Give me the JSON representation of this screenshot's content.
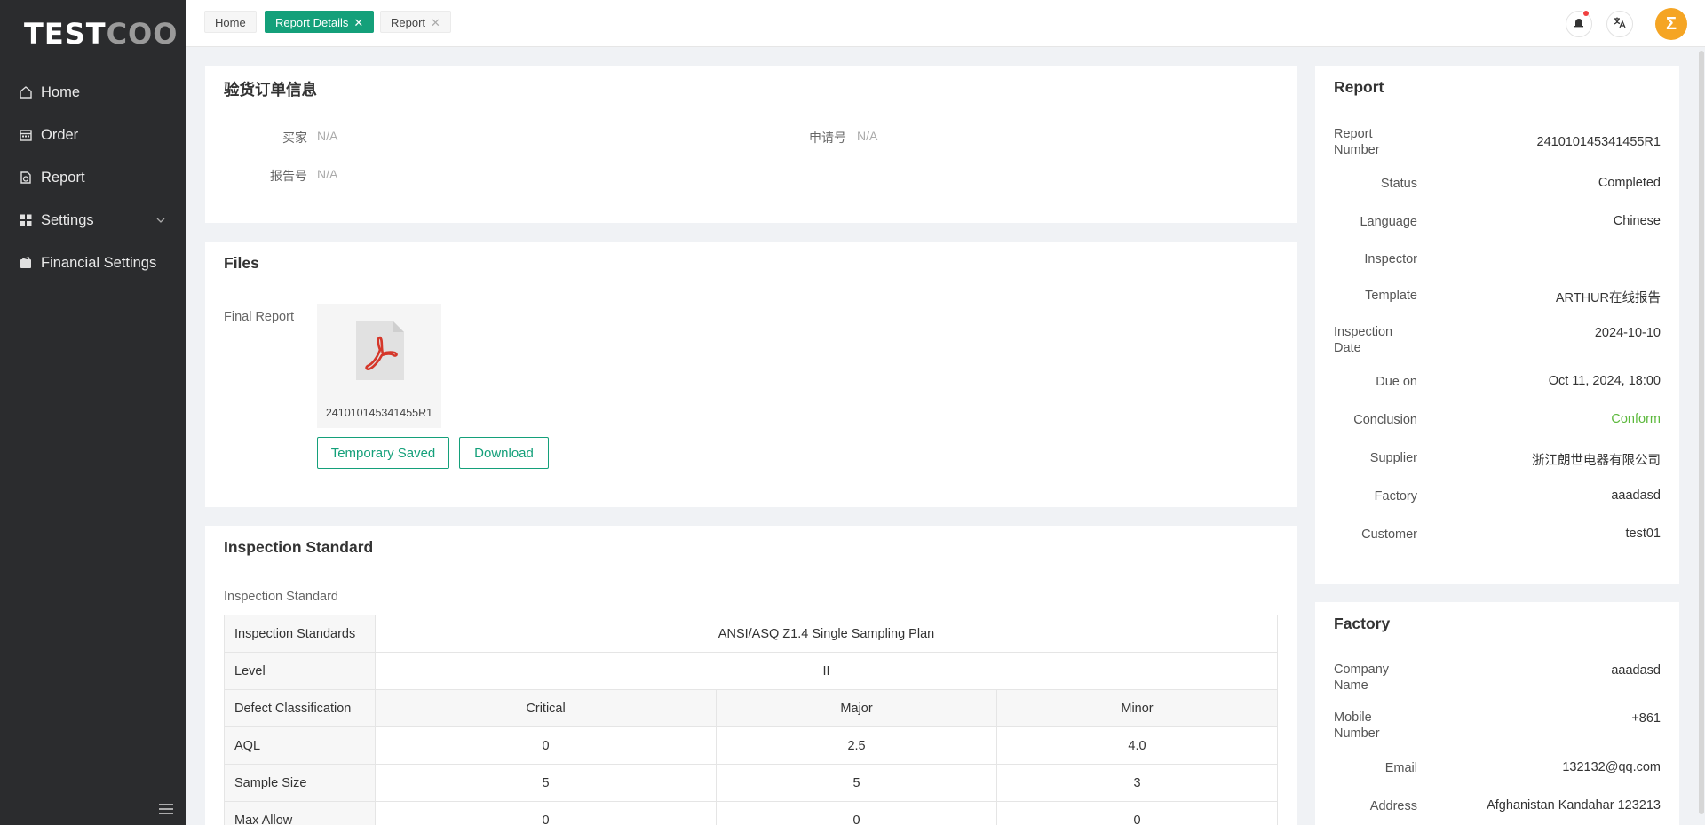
{
  "app": {
    "logo_part1": "TEST",
    "logo_part2": "COO"
  },
  "sidebar": {
    "items": [
      {
        "label": "Home",
        "icon": "home-icon"
      },
      {
        "label": "Order",
        "icon": "calendar-icon"
      },
      {
        "label": "Report",
        "icon": "report-icon"
      },
      {
        "label": "Settings",
        "icon": "grid-icon",
        "has_children": true
      },
      {
        "label": "Financial Settings",
        "icon": "wallet-icon"
      }
    ]
  },
  "tabs": [
    {
      "label": "Home"
    },
    {
      "label": "Report Details",
      "active": true,
      "closable": true
    },
    {
      "label": "Report",
      "closable": true
    }
  ],
  "topbar": {
    "avatar_letter": "Σ",
    "accent_color": "#14a07a"
  },
  "order_info": {
    "title": "验货订单信息",
    "fields": [
      {
        "label": "买家",
        "value": "N/A"
      },
      {
        "label": "申请号",
        "value": "N/A"
      },
      {
        "label": "报告号",
        "value": "N/A"
      }
    ]
  },
  "files": {
    "title": "Files",
    "final_report_label": "Final Report",
    "file_name": "241010145341455R1",
    "temp_saved_label": "Temporary Saved",
    "download_label": "Download"
  },
  "inspection_standard": {
    "title": "Inspection Standard",
    "subtitle": "Inspection Standard",
    "rows": {
      "standards_label": "Inspection Standards",
      "standards_value": "ANSI/ASQ Z1.4 Single Sampling Plan",
      "level_label": "Level",
      "level_value": "II",
      "defect_label": "Defect Classification",
      "headers": [
        "Critical",
        "Major",
        "Minor"
      ],
      "aql_label": "AQL",
      "aql": [
        "0",
        "2.5",
        "4.0"
      ],
      "sample_label": "Sample Size",
      "sample": [
        "5",
        "5",
        "3"
      ],
      "max_label": "Max Allow",
      "max": [
        "0",
        "0",
        "0"
      ]
    }
  },
  "report_panel": {
    "title": "Report",
    "number_label": "Report Number",
    "number": "241010145341455R1",
    "status_label": "Status",
    "status": "Completed",
    "language_label": "Language",
    "language": "Chinese",
    "inspector_label": "Inspector",
    "inspector": "",
    "template_label": "Template",
    "template": "ARTHUR在线报告",
    "inspection_date_label": "Inspection Date",
    "inspection_date": "2024-10-10",
    "due_label": "Due on",
    "due": "Oct 11, 2024, 18:00",
    "conclusion_label": "Conclusion",
    "conclusion": "Conform",
    "conclusion_color": "#5bb83b",
    "supplier_label": "Supplier",
    "supplier": "浙江朗世电器有限公司",
    "factory_label": "Factory",
    "factory": "aaadasd",
    "customer_label": "Customer",
    "customer": "test01"
  },
  "factory_panel": {
    "title": "Factory",
    "company_label": "Company Name",
    "company": "aaadasd",
    "mobile_label": "Mobile Number",
    "mobile": "+861",
    "email_label": "Email",
    "email": "132132@qq.com",
    "address_label": "Address",
    "address": "Afghanistan Kandahar 123213"
  }
}
